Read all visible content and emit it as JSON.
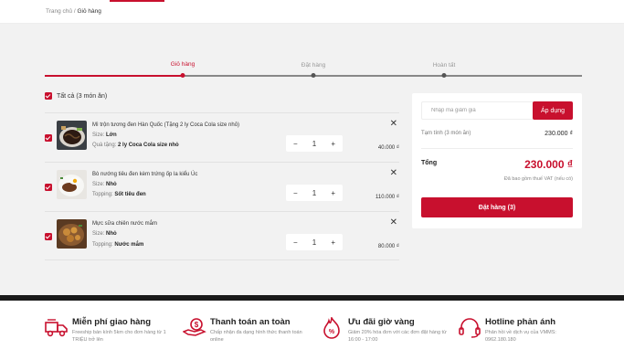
{
  "breadcrumb": {
    "home": "Trang chủ",
    "separator": "/",
    "current": "Giỏ hàng"
  },
  "steps": [
    {
      "label": "Giỏ hàng",
      "active": true
    },
    {
      "label": "Đặt hàng",
      "active": false
    },
    {
      "label": "Hoàn tất",
      "active": false
    }
  ],
  "cart": {
    "select_all_label": "Tất cả (3 món ăn)",
    "items": [
      {
        "name": "Mì trộn tương đen Hàn Quốc (Tặng 2 ly Coca Cola size nhỏ)",
        "line1_label": "Size: ",
        "line1_value": "Lớn",
        "line2_label": "Quà tặng: ",
        "line2_value": "2 ly Coca Cola size nhỏ",
        "quantity": "1",
        "price": "40.000 ₫"
      },
      {
        "name": "Bò nướng tiêu đen kèm trứng ốp la kiểu Úc",
        "line1_label": "Size: ",
        "line1_value": "Nhỏ",
        "line2_label": "Topping: ",
        "line2_value": "Sốt tiêu đen",
        "quantity": "1",
        "price": "110.000 ₫"
      },
      {
        "name": "Mực sữa chiên nước mắm",
        "line1_label": "Size: ",
        "line1_value": "Nhỏ",
        "line2_label": "Topping: ",
        "line2_value": "Nước mắm",
        "quantity": "1",
        "price": "80.000 ₫"
      }
    ],
    "minus": "−",
    "plus": "+",
    "remove": "✕"
  },
  "summary": {
    "coupon_placeholder": "Nhập mã giảm giá",
    "apply_label": "Áp dụng",
    "subtotal_label": "Tạm tính (3 món ăn)",
    "subtotal_value": "230.000 ₫",
    "total_label": "Tổng",
    "total_value": "230.000 ₫",
    "vat_note": "Đã bao gồm thuế VAT (nếu có)",
    "order_button": "Đặt hàng (3)"
  },
  "features": [
    {
      "icon": "delivery-truck-icon",
      "title": "Miễn phí giao hàng",
      "desc": "Freeship bán kính 5km cho đơn hàng từ 1 TRIỆU trở lên"
    },
    {
      "icon": "hand-money-icon",
      "title": "Thanh toán an toàn",
      "desc": "Chấp nhận đa dạng hình thức thanh toán online"
    },
    {
      "icon": "discount-flame-icon",
      "title": "Ưu đãi giờ vàng",
      "desc": "Giảm 20% hóa đơn với các đơn đặt hàng từ 16:00 - 17:00"
    },
    {
      "icon": "headset-icon",
      "title": "Hotline phản ánh",
      "desc": "Phản hồi về dịch vụ của VMMS: 0962.180.180"
    }
  ],
  "colors": {
    "accent": "#c8102e",
    "background": "#f2f2f2"
  }
}
